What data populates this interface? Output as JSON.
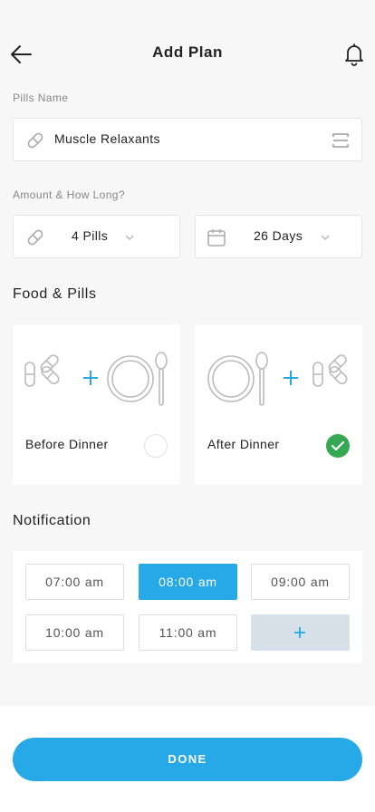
{
  "header": {
    "title": "Add Plan",
    "back_icon": "arrow-left-icon",
    "bell_icon": "bell-icon"
  },
  "pills_name": {
    "label": "Pills Name",
    "value": "Muscle Relaxants",
    "leading_icon": "pill-icon",
    "trailing_icon": "scan-icon"
  },
  "amount": {
    "label": "Amount & How Long?",
    "pills_value": "4 Pills",
    "days_value": "26 Days",
    "pills_icon": "pill-icon",
    "days_icon": "calendar-icon"
  },
  "food": {
    "title": "Food & Pills",
    "options": [
      {
        "label": "Before Dinner",
        "selected": false
      },
      {
        "label": "After Dinner",
        "selected": true
      }
    ]
  },
  "notification": {
    "title": "Notification",
    "times": [
      "07:00 am",
      "08:00 am",
      "09:00 am",
      "10:00 am",
      "11:00 am"
    ],
    "selected": "08:00 am",
    "add_label": "+"
  },
  "done_label": "DONE",
  "colors": {
    "accent": "#26a9e6",
    "check": "#34a853",
    "add_bg": "#d6e1e9"
  }
}
